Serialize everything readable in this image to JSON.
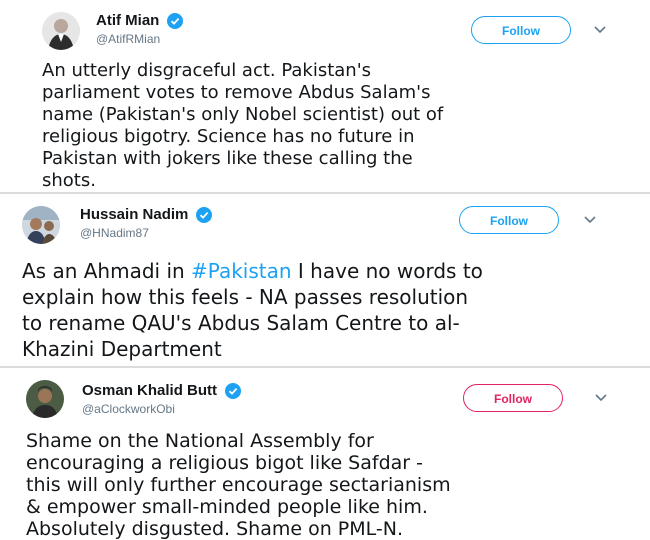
{
  "tweets": [
    {
      "display_name": "Atif Mian",
      "handle": "@AtifRMian",
      "follow_label": "Follow",
      "text": "An utterly disgraceful act. Pakistan's\nparliament votes to remove Abdus Salam's\nname (Pakistan's only Nobel scientist) out of\nreligious bigotry. Science has no future in\nPakistan with jokers like these calling the\nshots."
    },
    {
      "display_name": "Hussain Nadim",
      "handle": "@HNadim87",
      "follow_label": "Follow",
      "text_before": "As an Ahmadi in ",
      "hashtag": "#Pakistan",
      "text_after": " I have no words to\nexplain how this feels - NA passes resolution\nto rename QAU's Abdus Salam Centre to al-\nKhazini Department"
    },
    {
      "display_name": "Osman Khalid Butt",
      "handle": "@aClockworkObi",
      "follow_label": "Follow",
      "text": "Shame on the National Assembly for\nencouraging a religious bigot like Safdar -\nthis will only further encourage sectarianism\n& empower small-minded people like him.\nAbsolutely disgusted. Shame on PML-N."
    }
  ],
  "colors": {
    "brand_blue": "#1da1f2",
    "follow_red": "#e0245e",
    "text": "#14171a",
    "secondary": "#657786"
  },
  "icons": [
    "verified-badge-icon",
    "chevron-down-icon",
    "avatar"
  ]
}
